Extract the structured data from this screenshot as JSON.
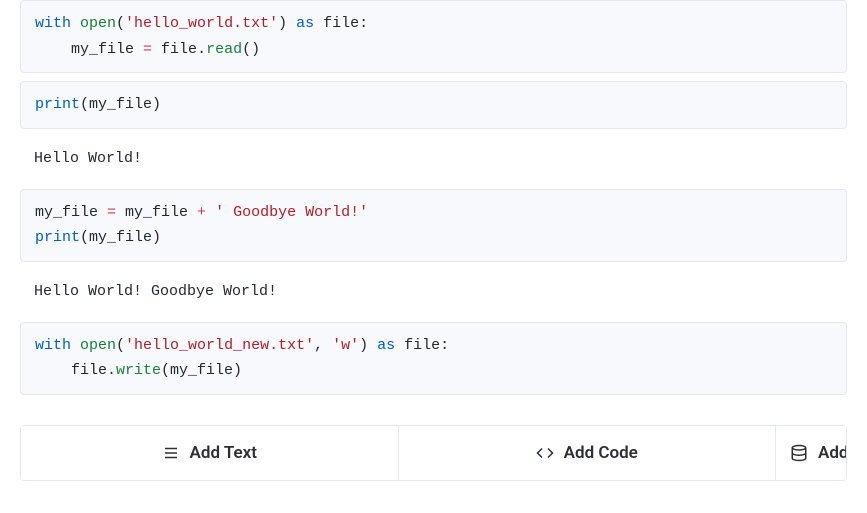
{
  "cells": [
    {
      "type": "code",
      "tokens": [
        {
          "t": "with ",
          "c": "kw"
        },
        {
          "t": "open",
          "c": "fn"
        },
        {
          "t": "(",
          "c": "id"
        },
        {
          "t": "'hello_world.txt'",
          "c": "str"
        },
        {
          "t": ") ",
          "c": "id"
        },
        {
          "t": "as",
          "c": "kw"
        },
        {
          "t": " file:",
          "c": "id"
        },
        {
          "t": "\n    my_file ",
          "c": "id"
        },
        {
          "t": "=",
          "c": "op"
        },
        {
          "t": " file",
          "c": "id"
        },
        {
          "t": ".",
          "c": "id"
        },
        {
          "t": "read",
          "c": "fn"
        },
        {
          "t": "()",
          "c": "id"
        }
      ]
    },
    {
      "type": "code",
      "tokens": [
        {
          "t": "print",
          "c": "kw"
        },
        {
          "t": "(my_file)",
          "c": "id"
        }
      ]
    },
    {
      "type": "output",
      "text": "Hello World!"
    },
    {
      "type": "code",
      "tokens": [
        {
          "t": "my_file ",
          "c": "id"
        },
        {
          "t": "=",
          "c": "op"
        },
        {
          "t": " my_file ",
          "c": "id"
        },
        {
          "t": "+",
          "c": "op"
        },
        {
          "t": " ",
          "c": "id"
        },
        {
          "t": "' Goodbye World!'",
          "c": "str"
        },
        {
          "t": "\n",
          "c": "id"
        },
        {
          "t": "print",
          "c": "kw"
        },
        {
          "t": "(my_file)",
          "c": "id"
        }
      ]
    },
    {
      "type": "output",
      "text": "Hello World! Goodbye World!"
    },
    {
      "type": "code",
      "tokens": [
        {
          "t": "with ",
          "c": "kw"
        },
        {
          "t": "open",
          "c": "fn"
        },
        {
          "t": "(",
          "c": "id"
        },
        {
          "t": "'hello_world_new.txt'",
          "c": "str"
        },
        {
          "t": ", ",
          "c": "id"
        },
        {
          "t": "'w'",
          "c": "str"
        },
        {
          "t": ") ",
          "c": "id"
        },
        {
          "t": "as",
          "c": "kw"
        },
        {
          "t": " file:",
          "c": "id"
        },
        {
          "t": "\n    file",
          "c": "id"
        },
        {
          "t": ".",
          "c": "id"
        },
        {
          "t": "write",
          "c": "fn"
        },
        {
          "t": "(my_file)",
          "c": "id"
        }
      ]
    }
  ],
  "toolbar": {
    "add_text": "Add Text",
    "add_code": "Add Code",
    "add_partial": "Add"
  }
}
